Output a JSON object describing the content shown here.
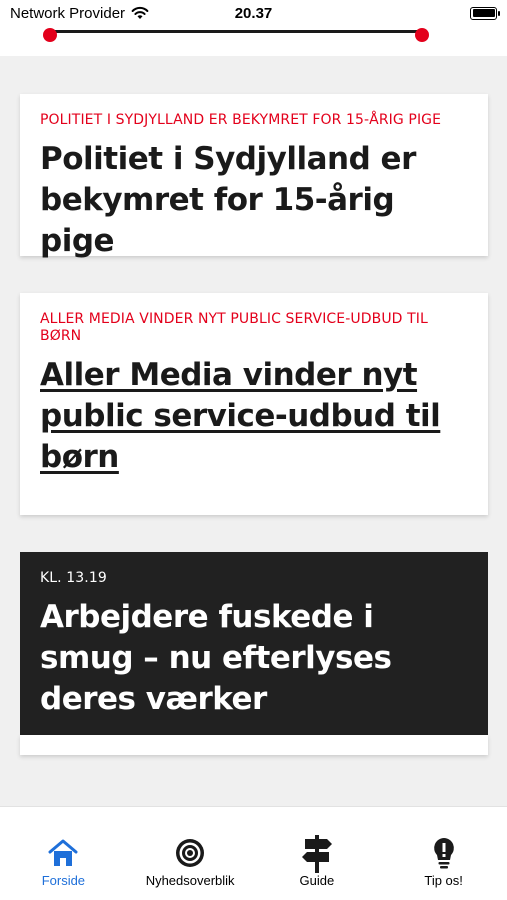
{
  "status_bar": {
    "carrier": "Network Provider",
    "time": "20.37"
  },
  "articles": [
    {
      "kicker": "POLITIET I SYDJYLLAND ER BEKYMRET FOR 15-ÅRIG PIGE",
      "title": "Politiet i Sydjylland er bekymret for 15-årig pige"
    },
    {
      "kicker": "ALLER MEDIA VINDER NYT PUBLIC SERVICE-UDBUD TIL BØRN",
      "title": "Aller Media vinder nyt public service-udbud til børn"
    },
    {
      "kicker": "KL. 13.19",
      "title": "Arbejdere fuskede i smug – nu efterlyses deres værker"
    }
  ],
  "tabbar": {
    "items": [
      {
        "label": "Forside",
        "icon": "home-icon"
      },
      {
        "label": "Nyhedsoverblik",
        "icon": "target-icon"
      },
      {
        "label": "Guide",
        "icon": "signpost-icon"
      },
      {
        "label": "Tip os!",
        "icon": "lightbulb-icon"
      }
    ]
  },
  "colors": {
    "accent_red": "#e3001b",
    "active_blue": "#1e6fd9",
    "dark_card": "#212121"
  }
}
